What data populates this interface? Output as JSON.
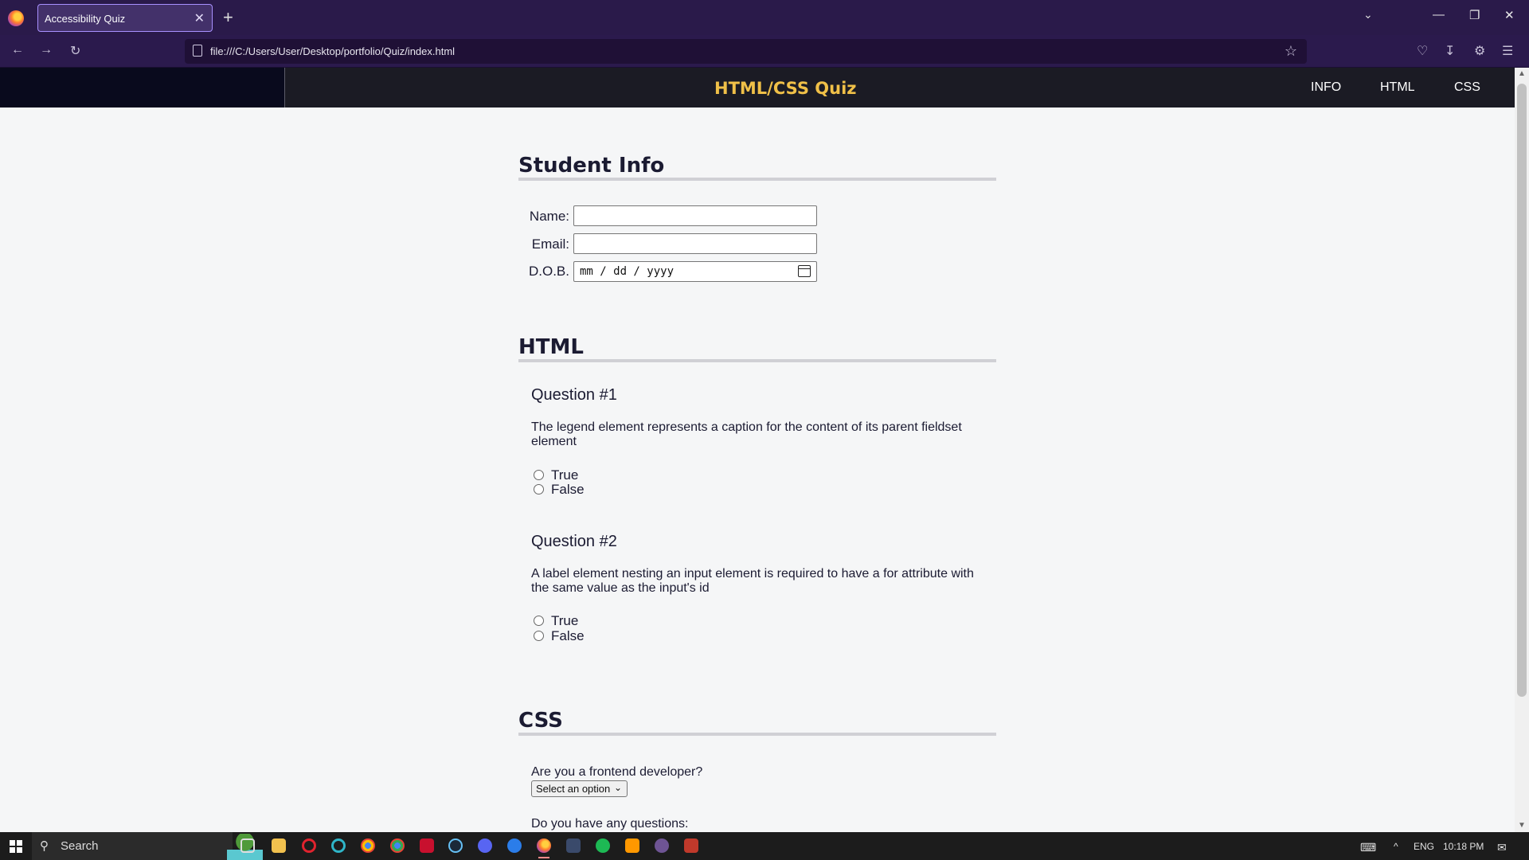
{
  "browser": {
    "tab_title": "Accessibility Quiz",
    "tab_close": "✕",
    "new_tab": "+",
    "url": "file:///C:/Users/User/Desktop/portfolio/Quiz/index.html"
  },
  "header": {
    "title": "HTML/CSS Quiz",
    "nav": [
      "INFO",
      "HTML",
      "CSS"
    ]
  },
  "student_info": {
    "heading": "Student Info",
    "name_label": "Name:",
    "email_label": "Email:",
    "dob_label": "D.O.B.",
    "dob_placeholder": "mm / dd / yyyy"
  },
  "html_section": {
    "heading": "HTML",
    "questions": [
      {
        "title": "Question #1",
        "text": "The legend element represents a caption for the content of its parent fieldset element",
        "options": [
          "True",
          "False"
        ]
      },
      {
        "title": "Question #2",
        "text": "A label element nesting an input element is required to have a for attribute with the same value as the input's id",
        "options": [
          "True",
          "False"
        ]
      }
    ]
  },
  "css_section": {
    "heading": "CSS",
    "frontend_question": "Are you a frontend developer?",
    "select_value": "Select an option",
    "questions_label": "Do you have any questions:"
  },
  "taskbar": {
    "search_text": "Search",
    "lang": "ENG",
    "time": "10:18 PM"
  },
  "colors": {
    "title_accent": "#f0c048",
    "header_bg": "#1b1b24",
    "page_bg": "#f5f6f7",
    "browser_chrome": "#2b1a4d"
  }
}
